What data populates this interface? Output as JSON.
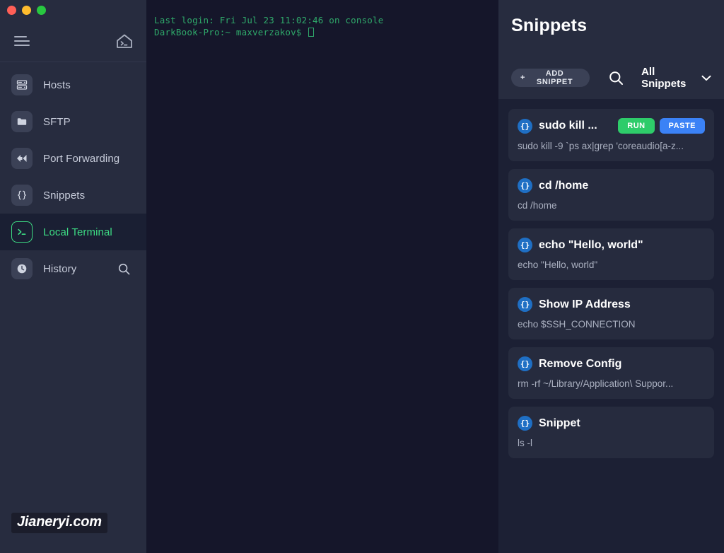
{
  "window": {
    "controls": [
      {
        "name": "close",
        "color": "#ff5f57"
      },
      {
        "name": "minimize",
        "color": "#febc2e"
      },
      {
        "name": "zoom",
        "color": "#28c840"
      }
    ]
  },
  "sidebar": {
    "toolbar": {
      "menu_icon": "hamburger-icon",
      "home_icon": "home-terminal-icon"
    },
    "items": [
      {
        "label": "Hosts",
        "icon": "server-icon",
        "active": false
      },
      {
        "label": "SFTP",
        "icon": "folder-icon",
        "active": false
      },
      {
        "label": "Port Forwarding",
        "icon": "arrows-forward-icon",
        "active": false
      },
      {
        "label": "Snippets",
        "icon": "braces-icon",
        "active": false
      },
      {
        "label": "Local Terminal",
        "icon": "terminal-prompt-icon",
        "active": true
      },
      {
        "label": "History",
        "icon": "clock-icon",
        "active": false
      }
    ],
    "history_search_icon": "search-icon",
    "watermark": "Jianeryi.com"
  },
  "terminal": {
    "lines": [
      "Last login: Fri Jul 23 11:02:46 on console",
      "DarkBook-Pro:~ maxverzakov$ "
    ],
    "prompt_cursor": true,
    "text_color": "#2fa86a",
    "background": "#15162a"
  },
  "snippets_panel": {
    "title": "Snippets",
    "add_button": {
      "label": "ADD SNIPPET",
      "plus": "+"
    },
    "search_icon": "search-icon",
    "filter": {
      "label": "All Snippets",
      "chevron_icon": "chevron-down-icon"
    },
    "badge_glyph": "{}",
    "items": [
      {
        "name": "sudo kill ...",
        "command": "sudo kill -9 `ps ax|grep 'coreaudio[a-z...",
        "actions": [
          {
            "label": "RUN",
            "color": "#2ecc6a"
          },
          {
            "label": "PASTE",
            "color": "#3b82f6"
          }
        ]
      },
      {
        "name": "cd /home",
        "command": "cd /home",
        "actions": []
      },
      {
        "name": "echo \"Hello, world\"",
        "command": "echo \"Hello, world\"",
        "actions": []
      },
      {
        "name": "Show IP Address",
        "command": "echo $SSH_CONNECTION",
        "actions": []
      },
      {
        "name": "Remove Config",
        "command": "rm -rf ~/Library/Application\\ Suppor...",
        "actions": []
      },
      {
        "name": "Snippet",
        "command": "ls -l",
        "actions": []
      }
    ]
  },
  "colors": {
    "sidebar_bg": "#272c3f",
    "terminal_bg": "#15162a",
    "panel_bg": "#1c2034",
    "card_bg": "#262b3e",
    "accent_green": "#3ddc84",
    "accent_blue": "#3b82f6"
  }
}
